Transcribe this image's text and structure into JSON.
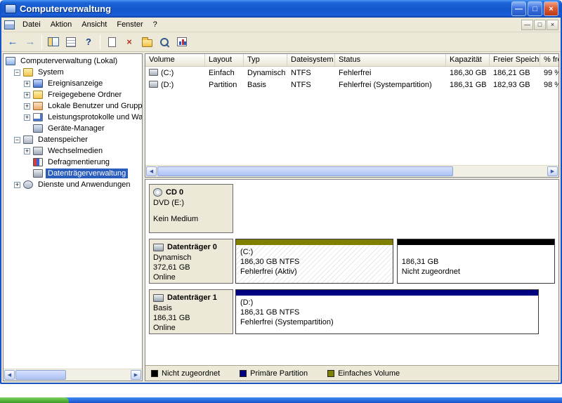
{
  "titlebar": {
    "title": "Computerverwaltung"
  },
  "window_controls": {
    "minimize": "—",
    "maximize": "□",
    "close": "×"
  },
  "menubar": {
    "items": [
      "Datei",
      "Aktion",
      "Ansicht",
      "Fenster",
      "?"
    ]
  },
  "mdi_controls": {
    "minimize": "—",
    "restore": "□",
    "close": "×"
  },
  "toolbar": {
    "back": "←",
    "forward": "→",
    "help": "?",
    "delete": "×"
  },
  "expand_icons": {
    "plus": "+",
    "minus": "−"
  },
  "scroll_icons": {
    "left": "◀",
    "right": "▶"
  },
  "tree": {
    "items": [
      {
        "label": "Computerverwaltung (Lokal)"
      },
      {
        "label": "System"
      },
      {
        "label": "Ereignisanzeige"
      },
      {
        "label": "Freigegebene Ordner"
      },
      {
        "label": "Lokale Benutzer und Gruppe"
      },
      {
        "label": "Leistungsprotokolle und War"
      },
      {
        "label": "Geräte-Manager"
      },
      {
        "label": "Datenspeicher"
      },
      {
        "label": "Wechselmedien"
      },
      {
        "label": "Defragmentierung"
      },
      {
        "label": "Datenträgerverwaltung"
      },
      {
        "label": "Dienste und Anwendungen"
      }
    ]
  },
  "volume_list": {
    "columns": [
      "Volume",
      "Layout",
      "Typ",
      "Dateisystem",
      "Status",
      "Kapazität",
      "Freier Speicher",
      "% fre"
    ],
    "rows": [
      {
        "volume": "(C:)",
        "layout": "Einfach",
        "typ": "Dynamisch",
        "dateisystem": "NTFS",
        "status": "Fehlerfrei",
        "kapazitaet": "186,30 GB",
        "frei": "186,21 GB",
        "prozent": "99 %"
      },
      {
        "volume": "(D:)",
        "layout": "Partition",
        "typ": "Basis",
        "dateisystem": "NTFS",
        "status": "Fehlerfrei (Systempartition)",
        "kapazitaet": "186,31 GB",
        "frei": "182,93 GB",
        "prozent": "98 %"
      }
    ]
  },
  "graphical": {
    "cd": {
      "name": "CD 0",
      "drive": "DVD (E:)",
      "status": "Kein Medium"
    },
    "disks": [
      {
        "name": "Datenträger 0",
        "type": "Dynamisch",
        "size": "372,61 GB",
        "status": "Online",
        "partitions": [
          {
            "label": "(C:)",
            "size": "186,30 GB NTFS",
            "status": "Fehlerfrei (Aktiv)",
            "color": "#808000",
            "width": "49.4%"
          },
          {
            "label": "",
            "size": "186,31 GB",
            "status": "Nicht zugeordnet",
            "color": "#000000",
            "width": "49.4%"
          }
        ]
      },
      {
        "name": "Datenträger 1",
        "type": "Basis",
        "size": "186,31 GB",
        "status": "Online",
        "partitions": [
          {
            "label": "(D:)",
            "size": "186,31 GB NTFS",
            "status": "Fehlerfrei (Systempartition)",
            "color": "#000080",
            "width": "95%"
          }
        ]
      }
    ],
    "legend": [
      {
        "label": "Nicht zugeordnet",
        "color": "#000000"
      },
      {
        "label": "Primäre Partition",
        "color": "#000080"
      },
      {
        "label": "Einfaches Volume",
        "color": "#808000"
      }
    ]
  },
  "colors": {
    "selection": "#2b5dbc",
    "window_chrome": "#1652c8",
    "panel_background": "#ECE9D8"
  }
}
